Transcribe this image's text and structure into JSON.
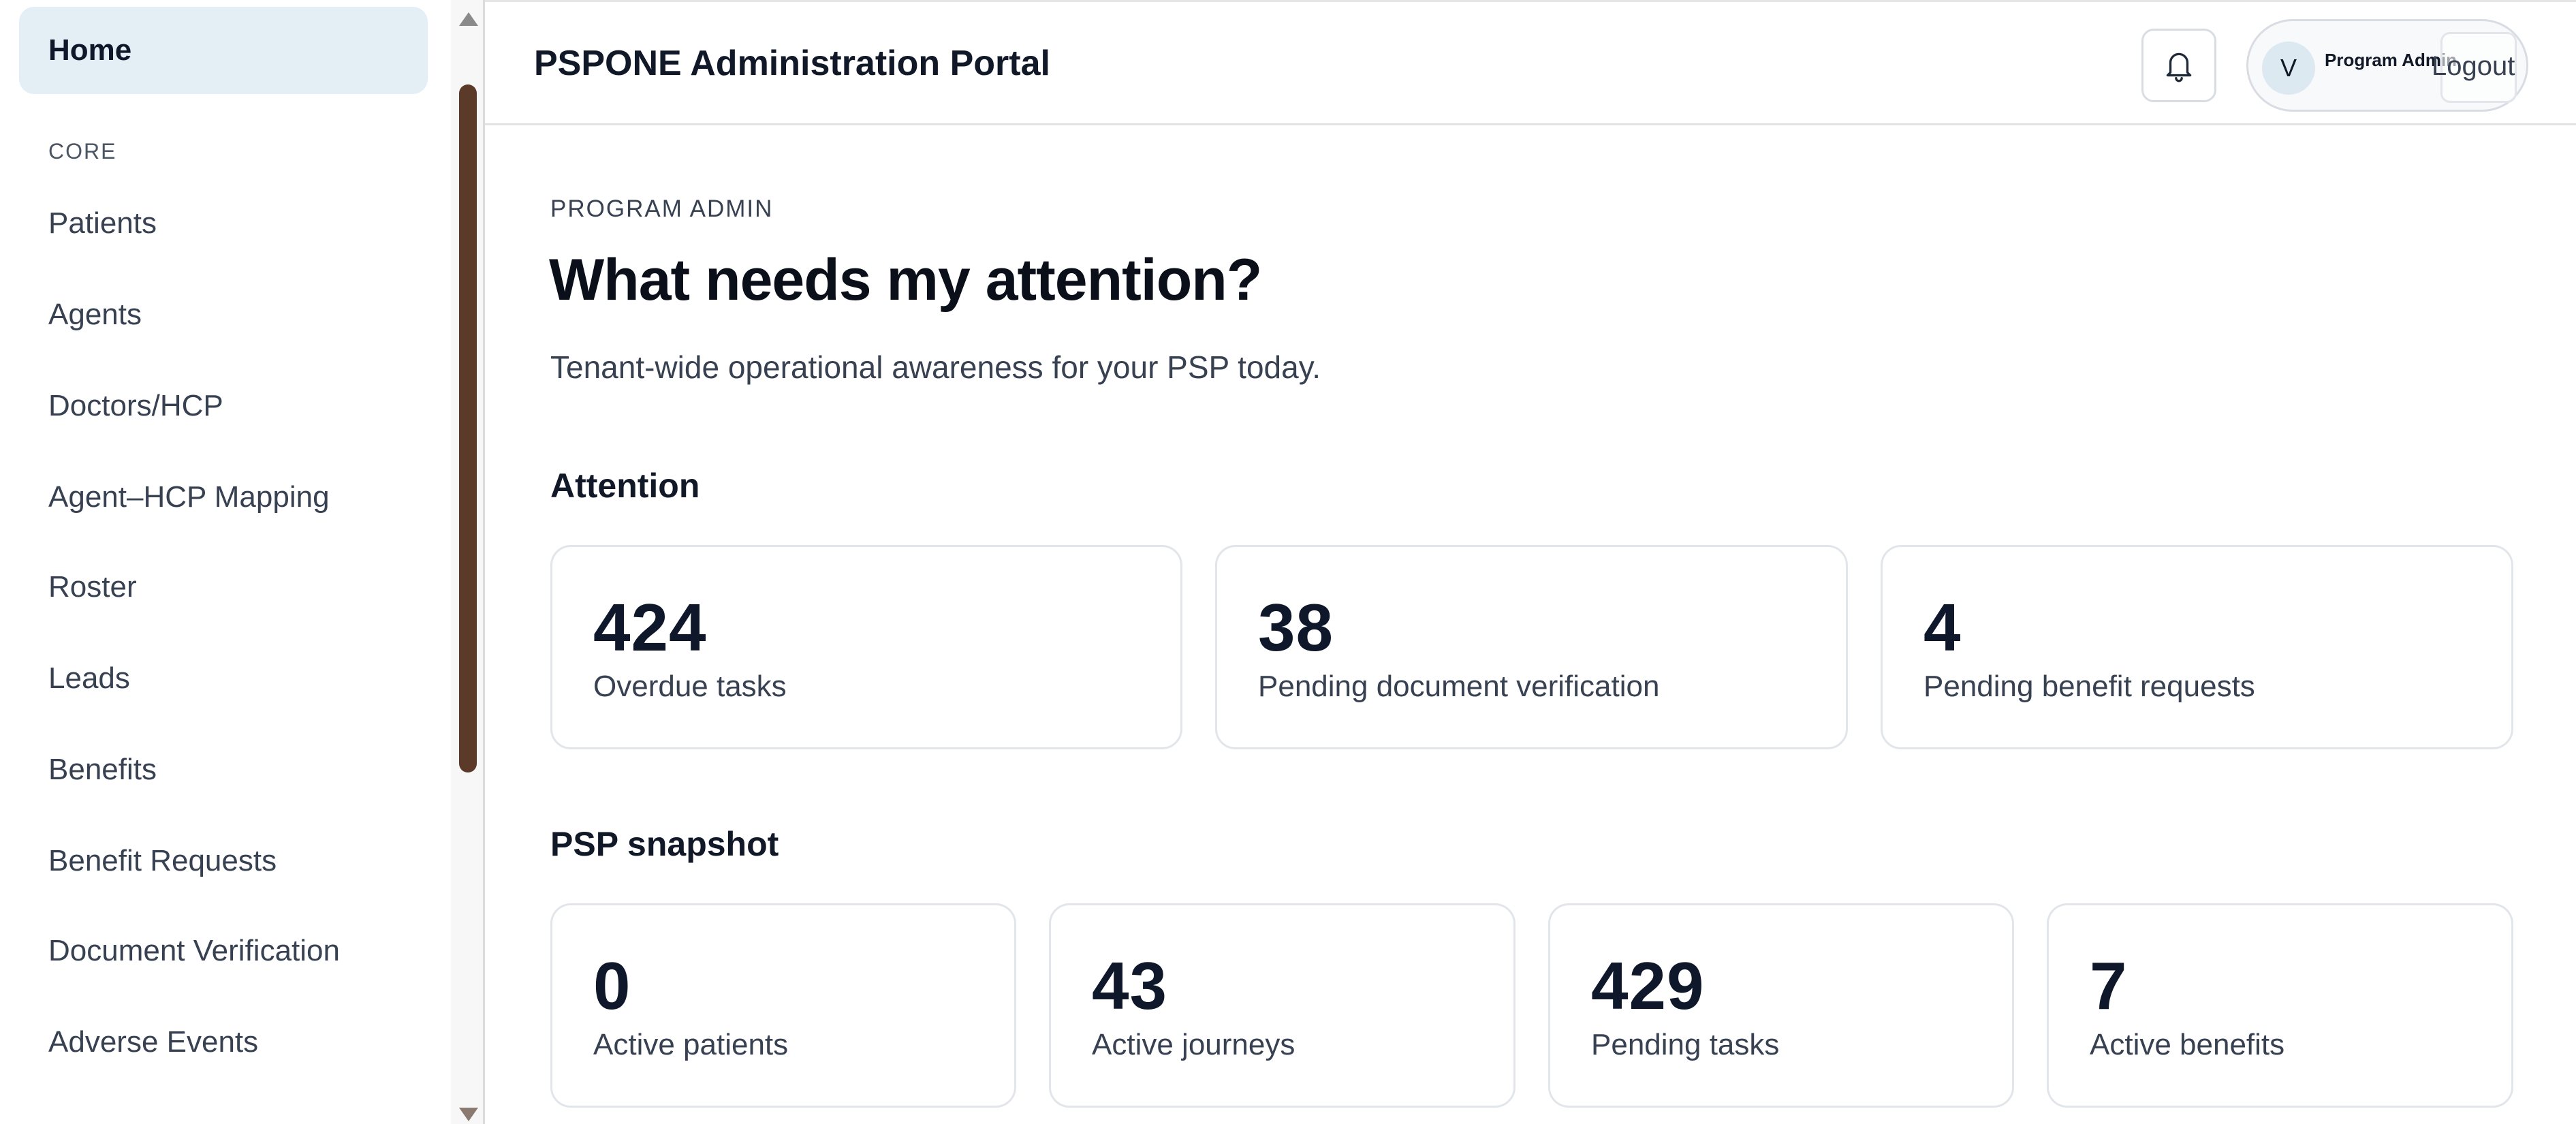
{
  "sidebar": {
    "items": [
      {
        "label": "Home"
      },
      {
        "label": "Patients"
      },
      {
        "label": "Agents"
      },
      {
        "label": "Doctors/HCP"
      },
      {
        "label": "Agent–HCP Mapping"
      },
      {
        "label": "Roster"
      },
      {
        "label": "Leads"
      },
      {
        "label": "Benefits"
      },
      {
        "label": "Benefit Requests"
      },
      {
        "label": "Document Verification"
      },
      {
        "label": "Adverse Events"
      }
    ],
    "section_core": "CORE",
    "active_item": "Home"
  },
  "header": {
    "title": "PSPONE Administration Portal",
    "user_initial": "V",
    "user_role": "Program Admin",
    "logout_label": "Logout",
    "bell_icon": "bell-icon"
  },
  "main": {
    "eyebrow": "PROGRAM ADMIN",
    "title": "What needs my attention?",
    "subtitle": "Tenant-wide operational awareness for your PSP today.",
    "attention": {
      "heading": "Attention",
      "cards": [
        {
          "value": "424",
          "label": "Overdue tasks"
        },
        {
          "value": "38",
          "label": "Pending document verification"
        },
        {
          "value": "4",
          "label": "Pending benefit requests"
        }
      ]
    },
    "snapshot": {
      "heading": "PSP snapshot",
      "cards": [
        {
          "value": "0",
          "label": "Active patients"
        },
        {
          "value": "43",
          "label": "Active journeys"
        },
        {
          "value": "429",
          "label": "Pending tasks"
        },
        {
          "value": "7",
          "label": "Active benefits"
        }
      ]
    }
  },
  "colors": {
    "active_nav_bg": "#e4eff5",
    "scroll_thumb": "#5b3a29",
    "card_border": "#e2e5ea"
  }
}
